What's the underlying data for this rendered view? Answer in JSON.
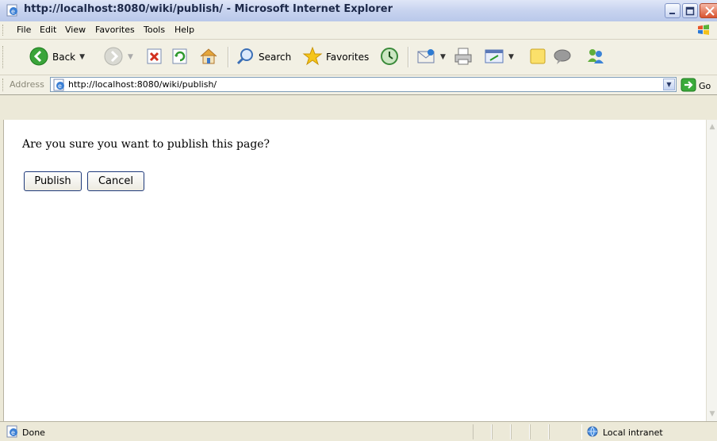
{
  "window": {
    "title": "http://localhost:8080/wiki/publish/ - Microsoft Internet Explorer"
  },
  "menubar": {
    "items": [
      "File",
      "Edit",
      "View",
      "Favorites",
      "Tools",
      "Help"
    ]
  },
  "toolbar": {
    "back_label": "Back",
    "search_label": "Search",
    "favorites_label": "Favorites"
  },
  "address": {
    "label": "Address",
    "url": "http://localhost:8080/wiki/publish/",
    "go_label": "Go"
  },
  "page": {
    "question": "Are you sure you want to publish this page?",
    "publish_label": "Publish",
    "cancel_label": "Cancel"
  },
  "status": {
    "text": "Done",
    "zone": "Local intranet"
  },
  "colors": {
    "titlebar": "#c7d3ef",
    "chrome": "#ece9d8",
    "button_border": "#1f3a7a",
    "close_button": "#d9532f"
  }
}
